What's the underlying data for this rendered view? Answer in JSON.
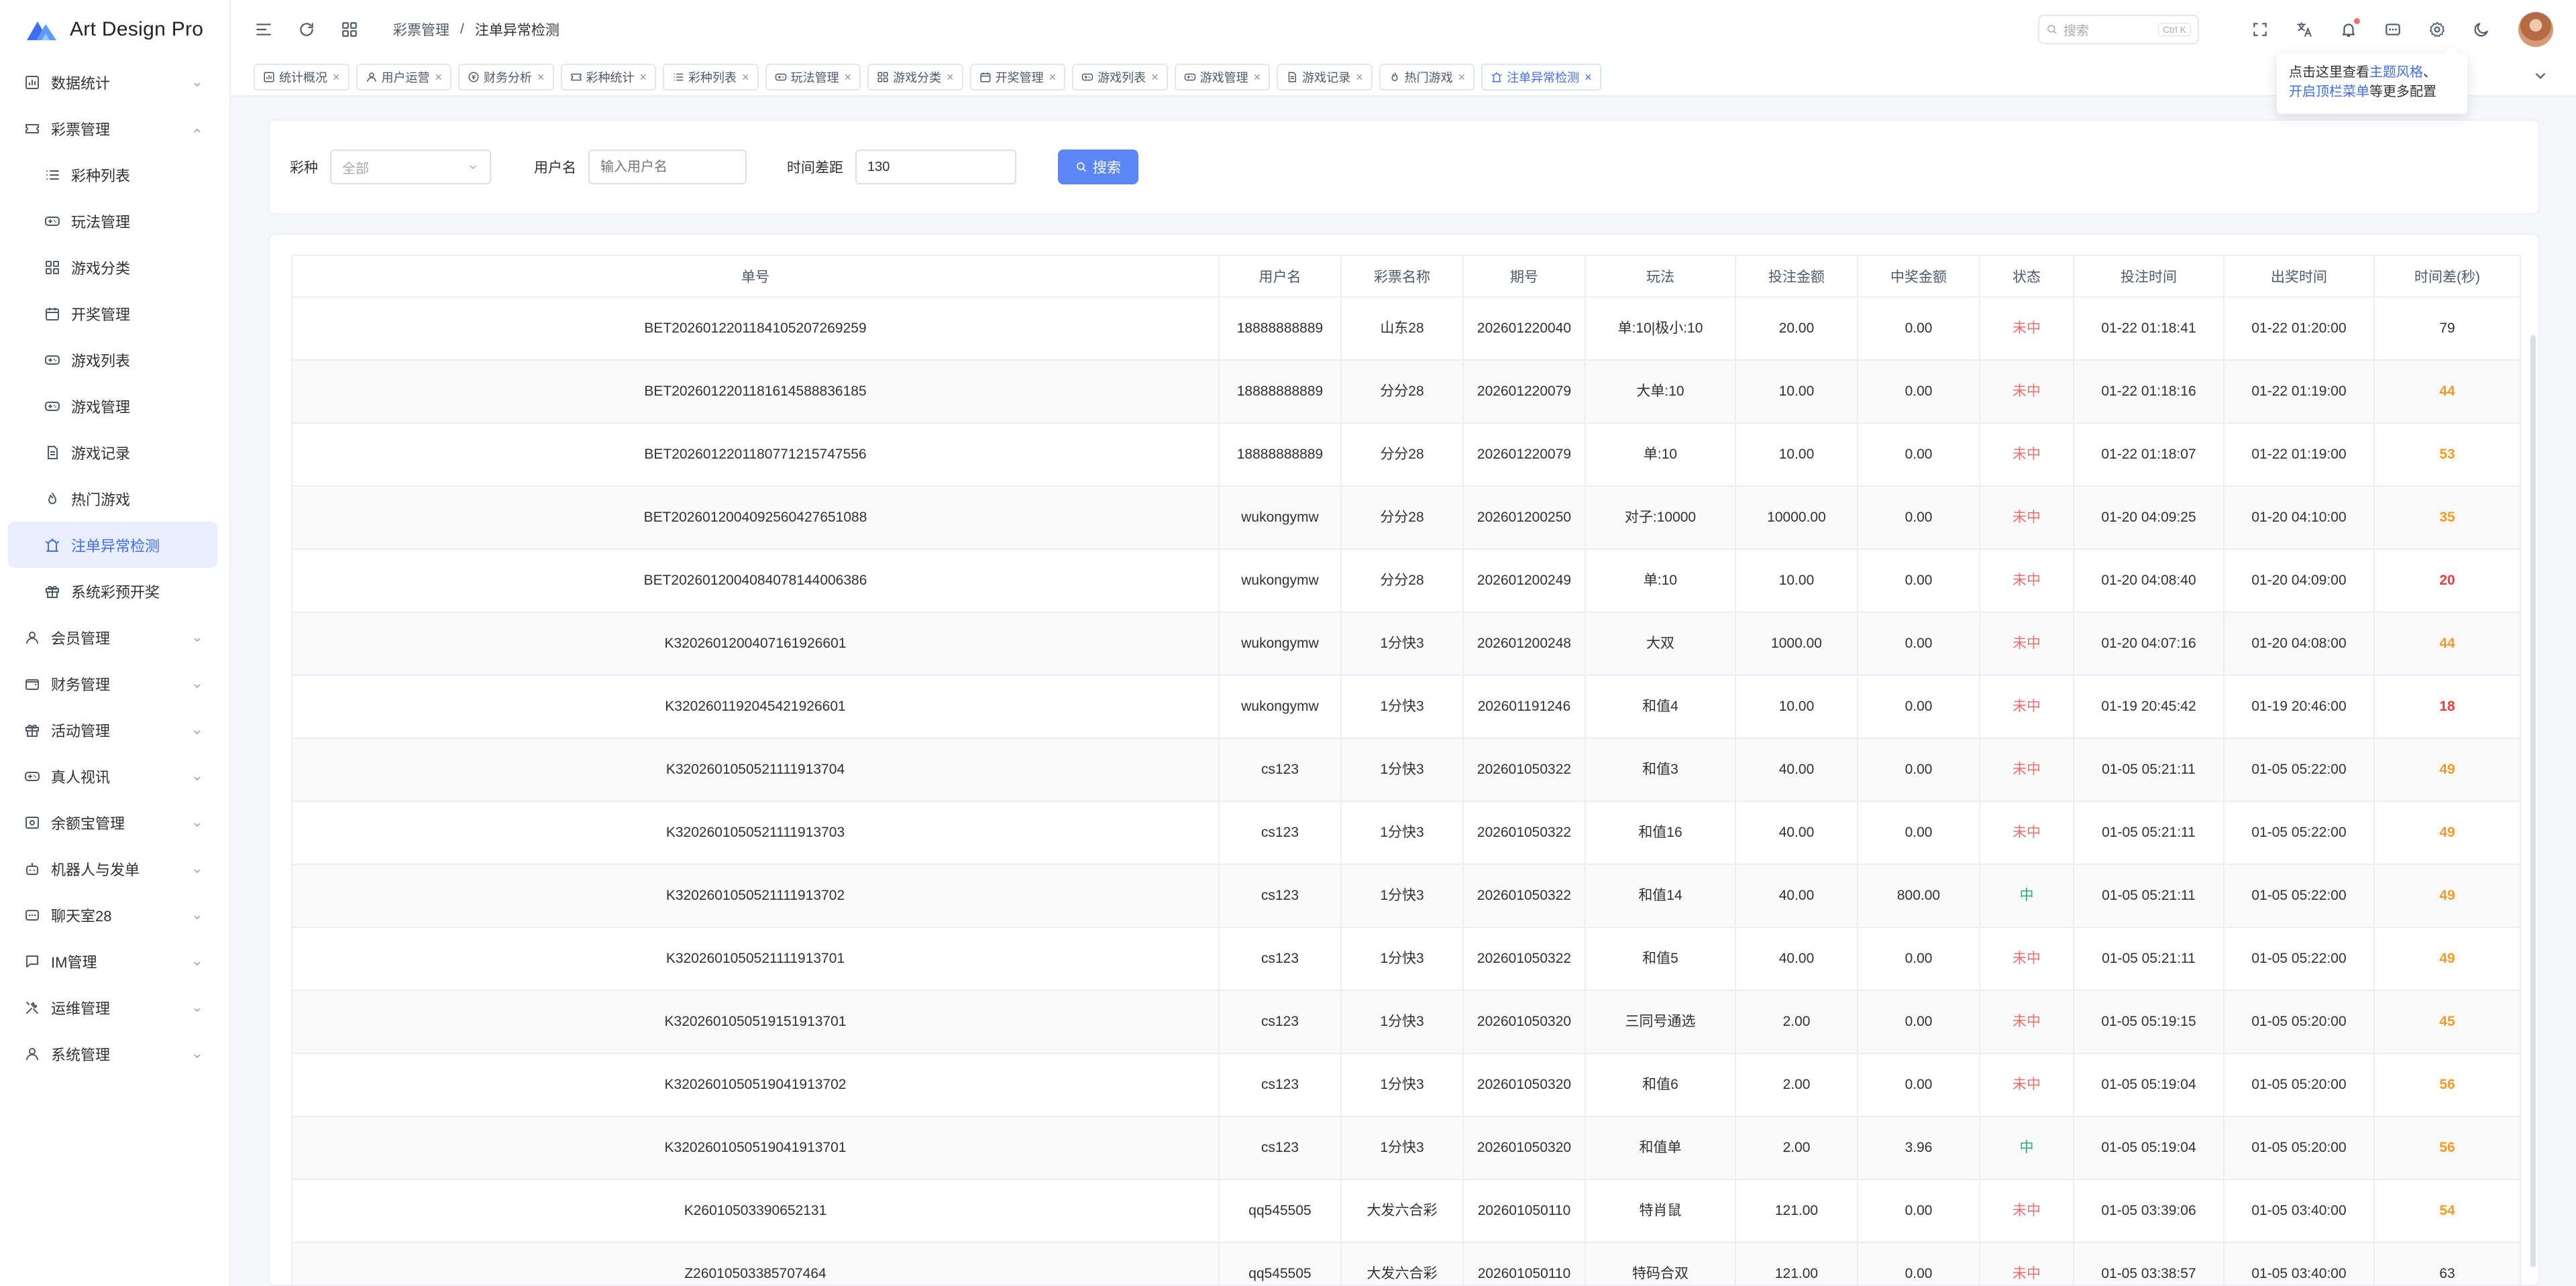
{
  "app": {
    "title": "Art Design Pro"
  },
  "sidebar": {
    "items": [
      {
        "label": "数据统计",
        "icon": "chart-icon",
        "expanded": false
      },
      {
        "label": "彩票管理",
        "icon": "ticket-icon",
        "expanded": true,
        "children": [
          {
            "label": "彩种列表",
            "icon": "list-icon"
          },
          {
            "label": "玩法管理",
            "icon": "gamepad-icon"
          },
          {
            "label": "游戏分类",
            "icon": "grid-icon"
          },
          {
            "label": "开奖管理",
            "icon": "calendar-icon"
          },
          {
            "label": "游戏列表",
            "icon": "gamepad-icon"
          },
          {
            "label": "游戏管理",
            "icon": "gamepad-icon"
          },
          {
            "label": "游戏记录",
            "icon": "document-icon"
          },
          {
            "label": "热门游戏",
            "icon": "fire-icon"
          },
          {
            "label": "注单异常检测",
            "icon": "alert-icon",
            "active": true
          },
          {
            "label": "系统彩预开奖",
            "icon": "gift-icon"
          }
        ]
      },
      {
        "label": "会员管理",
        "icon": "user-icon"
      },
      {
        "label": "财务管理",
        "icon": "wallet-icon"
      },
      {
        "label": "活动管理",
        "icon": "gift-icon"
      },
      {
        "label": "真人视讯",
        "icon": "gamepad-icon"
      },
      {
        "label": "余额宝管理",
        "icon": "safe-icon"
      },
      {
        "label": "机器人与发单",
        "icon": "robot-icon"
      },
      {
        "label": "聊天室28",
        "icon": "chat-icon"
      },
      {
        "label": "IM管理",
        "icon": "message-icon"
      },
      {
        "label": "运维管理",
        "icon": "tools-icon"
      },
      {
        "label": "系统管理",
        "icon": "user-icon"
      }
    ]
  },
  "header": {
    "breadcrumb": [
      "彩票管理",
      "/",
      "注单异常检测"
    ],
    "search_placeholder": "搜索",
    "search_shortcut": "Ctrl K"
  },
  "tabs": [
    {
      "label": "统计概况",
      "icon": "chart-icon"
    },
    {
      "label": "用户运营",
      "icon": "user-icon"
    },
    {
      "label": "财务分析",
      "icon": "money-icon"
    },
    {
      "label": "彩种统计",
      "icon": "ticket-icon"
    },
    {
      "label": "彩种列表",
      "icon": "list-icon"
    },
    {
      "label": "玩法管理",
      "icon": "gamepad-icon"
    },
    {
      "label": "游戏分类",
      "icon": "grid-icon"
    },
    {
      "label": "开奖管理",
      "icon": "calendar-icon"
    },
    {
      "label": "游戏列表",
      "icon": "gamepad-icon"
    },
    {
      "label": "游戏管理",
      "icon": "gamepad-icon"
    },
    {
      "label": "游戏记录",
      "icon": "document-icon"
    },
    {
      "label": "热门游戏",
      "icon": "fire-icon"
    },
    {
      "label": "注单异常检测",
      "icon": "alert-icon",
      "active": true
    }
  ],
  "tooltip": {
    "prefix": "点击这里查看",
    "link1": "主题风格",
    "sep": "、",
    "link2": "开启顶栏菜单",
    "suffix": "等更多配置"
  },
  "filters": {
    "lottery_label": "彩种",
    "lottery_placeholder": "全部",
    "username_label": "用户名",
    "username_placeholder": "输入用户名",
    "timediff_label": "时间差距",
    "timediff_value": "130",
    "search_button": "搜索"
  },
  "table": {
    "columns": [
      "单号",
      "用户名",
      "彩票名称",
      "期号",
      "玩法",
      "投注金额",
      "中奖金额",
      "状态",
      "投注时间",
      "出奖时间",
      "时间差(秒)"
    ],
    "rows": [
      [
        "BET2026012201184105207269259",
        "18888888889",
        "山东28",
        "202601220040",
        "单:10|极小:10",
        "20.00",
        "0.00",
        "未中",
        "01-22 01:18:41",
        "01-22 01:20:00",
        "79"
      ],
      [
        "BET2026012201181614588836185",
        "18888888889",
        "分分28",
        "202601220079",
        "大单:10",
        "10.00",
        "0.00",
        "未中",
        "01-22 01:18:16",
        "01-22 01:19:00",
        "44"
      ],
      [
        "BET2026012201180771215747556",
        "18888888889",
        "分分28",
        "202601220079",
        "单:10",
        "10.00",
        "0.00",
        "未中",
        "01-22 01:18:07",
        "01-22 01:19:00",
        "53"
      ],
      [
        "BET2026012004092560427651088",
        "wukongymw",
        "分分28",
        "202601200250",
        "对子:10000",
        "10000.00",
        "0.00",
        "未中",
        "01-20 04:09:25",
        "01-20 04:10:00",
        "35"
      ],
      [
        "BET2026012004084078144006386",
        "wukongymw",
        "分分28",
        "202601200249",
        "单:10",
        "10.00",
        "0.00",
        "未中",
        "01-20 04:08:40",
        "01-20 04:09:00",
        "20"
      ],
      [
        "K320260120040716192660​1",
        "wukongymw",
        "1分快3",
        "202601200248",
        "大双",
        "1000.00",
        "0.00",
        "未中",
        "01-20 04:07:16",
        "01-20 04:08:00",
        "44"
      ],
      [
        "K3202601192045421926601",
        "wukongymw",
        "1分快3",
        "202601191246",
        "和值4",
        "10.00",
        "0.00",
        "未中",
        "01-19 20:45:42",
        "01-19 20:46:00",
        "18"
      ],
      [
        "K3202601050521111913704",
        "cs123",
        "1分快3",
        "202601050322",
        "和值3",
        "40.00",
        "0.00",
        "未中",
        "01-05 05:21:11",
        "01-05 05:22:00",
        "49"
      ],
      [
        "K3202601050521111913703",
        "cs123",
        "1分快3",
        "202601050322",
        "和值16",
        "40.00",
        "0.00",
        "未中",
        "01-05 05:21:11",
        "01-05 05:22:00",
        "49"
      ],
      [
        "K3202601050521111913702",
        "cs123",
        "1分快3",
        "202601050322",
        "和值14",
        "40.00",
        "800.00",
        "中",
        "01-05 05:21:11",
        "01-05 05:22:00",
        "49"
      ],
      [
        "K3202601050521111913701",
        "cs123",
        "1分快3",
        "202601050322",
        "和值5",
        "40.00",
        "0.00",
        "未中",
        "01-05 05:21:11",
        "01-05 05:22:00",
        "49"
      ],
      [
        "K3202601050519151913701",
        "cs123",
        "1分快3",
        "202601050320",
        "三同号通选",
        "2.00",
        "0.00",
        "未中",
        "01-05 05:19:15",
        "01-05 05:20:00",
        "45"
      ],
      [
        "K3202601050519041913702",
        "cs123",
        "1分快3",
        "202601050320",
        "和值6",
        "2.00",
        "0.00",
        "未中",
        "01-05 05:19:04",
        "01-05 05:20:00",
        "56"
      ],
      [
        "K3202601050519041913701",
        "cs123",
        "1分快3",
        "202601050320",
        "和值单",
        "2.00",
        "3.96",
        "中",
        "01-05 05:19:04",
        "01-05 05:20:00",
        "56"
      ],
      [
        "K26010503390652131",
        "qq545505",
        "大发六合彩",
        "202601050110",
        "特肖鼠",
        "121.00",
        "0.00",
        "未中",
        "01-05 03:39:06",
        "01-05 03:40:00",
        "54"
      ],
      [
        "Z26010503385707464",
        "qq545505",
        "大发六合彩",
        "202601050110",
        "特码合双",
        "121.00",
        "0.00",
        "未中",
        "01-05 03:38:57",
        "01-05 03:40:00",
        "63"
      ]
    ]
  },
  "colors": {
    "accent": "#3f6df5",
    "miss": "#f56c6c",
    "hit": "#2bb06b",
    "diff_orange": "#f59a23",
    "diff_red": "#ef3b3b"
  }
}
